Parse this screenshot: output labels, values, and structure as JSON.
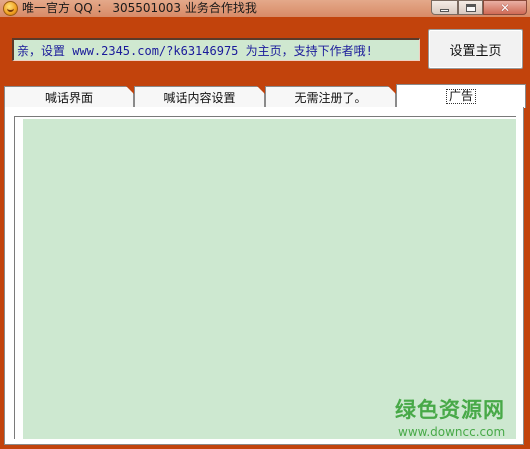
{
  "window": {
    "title": "唯一官方 QQ ： 305501003   业务合作找我"
  },
  "toolbar": {
    "link_text": "亲，设置  www.2345.com/?k63146975  为主页，支持下作者哦!",
    "set_home_label": "设置主页"
  },
  "tabs": [
    {
      "label": "喊话界面",
      "active": false
    },
    {
      "label": "喊话内容设置",
      "active": false
    },
    {
      "label": "无需注册了。",
      "active": false
    },
    {
      "label": "广告",
      "active": true
    }
  ],
  "watermark": {
    "brand": "绿色资源网",
    "url": "www.downcc.com"
  },
  "colors": {
    "frame": "#c2430c",
    "content_bg": "#cde8d0",
    "link_text": "#1a1a9a"
  }
}
